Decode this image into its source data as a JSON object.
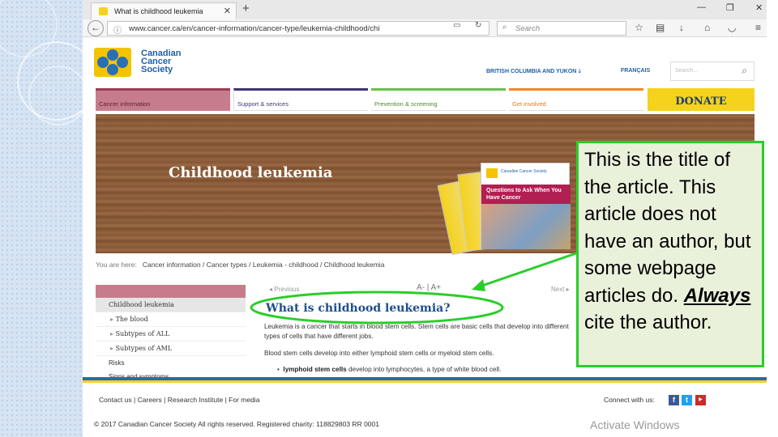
{
  "browser": {
    "tab_title": "What is childhood leukemia",
    "url": "www.cancer.ca/en/cancer-information/cancer-type/leukemia-childhood/chi",
    "search_placeholder": "Search"
  },
  "site": {
    "logo_text_lines": [
      "Canadian",
      "Cancer",
      "Society"
    ],
    "region": "BRITISH COLUMBIA AND YUKON",
    "language": "FRANÇAIS",
    "search_placeholder": "Search...",
    "nav": [
      "Cancer information",
      "Support & services",
      "Prevention & screening",
      "Get involved"
    ],
    "donate": "DONATE",
    "colors": {
      "cancer_info": "#c77c8c",
      "support": "#3d3577",
      "prevention": "#6abf4b",
      "get_involved": "#f08a24",
      "donate": "#f5d21b",
      "brand_blue": "#1e5fa8"
    }
  },
  "hero": {
    "title": "Childhood leukemia",
    "brochure_title": "Questions to Ask When You Have Cancer",
    "brochure_logo": "Canadian Cancer Society"
  },
  "breadcrumbs": {
    "prefix": "You are here:",
    "path": "Cancer information / Cancer types / Leukemia - childhood / Childhood leukemia"
  },
  "left_nav": {
    "items": [
      {
        "label": "Childhood leukemia",
        "type": "active"
      },
      {
        "label": "The blood",
        "type": "sub"
      },
      {
        "label": "Subtypes of ALL",
        "type": "sub"
      },
      {
        "label": "Subtypes of AML",
        "type": "sub"
      },
      {
        "label": "Risks",
        "type": "plain"
      },
      {
        "label": "Signs and symptoms",
        "type": "plain"
      }
    ]
  },
  "article": {
    "prev": "Previous",
    "next": "Next",
    "text_size": "A- | A+",
    "title": "What is childhood leukemia?",
    "paragraph1": "Leukemia is a cancer that starts in blood stem cells. Stem cells are basic cells that develop into different types of cells that have different jobs.",
    "paragraph2": "Blood stem cells develop into either lymphoid stem cells or myeloid stem cells.",
    "bullet_bold": "lymphoid stem cells",
    "bullet_rest": " develop into lymphocytes, a type of white blood cell."
  },
  "footer": {
    "links": "Contact us  |  Careers  |  Research Institute  |  For media",
    "connect": "Connect with us:",
    "copyright": "© 2017 Canadian Cancer Society All rights reserved. Registered charity: 118829803 RR 0001",
    "watermark": "Activate Windows"
  },
  "callout": {
    "text_before": "This is the title of the article. This article does not have an author, but some webpage articles do. ",
    "emphasis": "Always",
    "text_after": " cite the author.",
    "border_color": "#2ccc2c"
  }
}
